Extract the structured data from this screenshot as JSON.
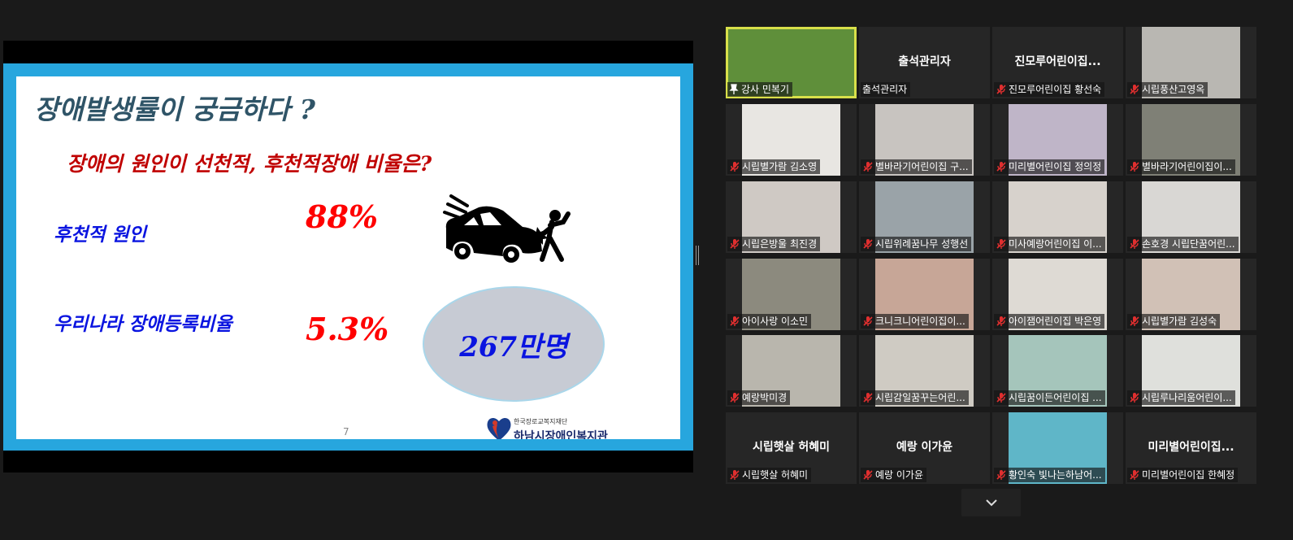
{
  "slide": {
    "title": "장애발생률이 궁금하다 ?",
    "question": "장애의 원인이 선천적, 후천적장애 비율은?",
    "acquired_label": "후천적 원인",
    "acquired_value": "88%",
    "registered_label": "우리나라 장애등록비율",
    "registered_value": "5.3%",
    "registered_count": "267만명",
    "page_number": "7",
    "org_sub": "한국장로교복지재단",
    "org_name": "하남시장애인복지관"
  },
  "participants": [
    {
      "label": "강사 민복기",
      "pinned": true,
      "active": true,
      "video": "#5f8f3a"
    },
    {
      "big": "출석관리자",
      "label": "출석관리자",
      "muted": false
    },
    {
      "big": "진모루어린이집...",
      "label": "진모루어린이집 황선숙",
      "muted": true
    },
    {
      "label": "시립풍산고영옥",
      "muted": true,
      "video": "#b9b7b2"
    },
    {
      "label": "시립별가람 김소영",
      "muted": true,
      "video": "#e8e6e2"
    },
    {
      "label": "별바라기어린이집 구...",
      "muted": true,
      "video": "#c8c4c0"
    },
    {
      "label": "미리별어린이집 정의정",
      "muted": true,
      "video": "#bfb5c8"
    },
    {
      "label": "별바라기어린이집이...",
      "muted": true,
      "video": "#7f8076"
    },
    {
      "label": "시립은방울 최진경",
      "muted": true,
      "video": "#cfc9c4"
    },
    {
      "label": "시립위례꿈나무 성행선",
      "muted": true,
      "video": "#9aa3a8"
    },
    {
      "label": "미사예랑어린이집 이...",
      "muted": true,
      "video": "#d7d2cc"
    },
    {
      "label": "손호경 시립단꿈어린...",
      "muted": true,
      "video": "#d9d7d4"
    },
    {
      "label": "아이사랑 이소민",
      "muted": true,
      "video": "#8c8a7e"
    },
    {
      "label": "크니크니어린이집이...",
      "muted": true,
      "video": "#c7a697"
    },
    {
      "label": "아이잼어린이집 박은영",
      "muted": true,
      "video": "#dedad4"
    },
    {
      "label": "시립별가람 김성숙",
      "muted": true,
      "video": "#d1c1b6"
    },
    {
      "label": "예랑박미경",
      "muted": true,
      "video": "#b9b6ad"
    },
    {
      "label": "시립감일꿈꾸는어린...",
      "muted": true,
      "video": "#cfcbc3"
    },
    {
      "label": "시립꿈이든어린이집 ...",
      "muted": true,
      "video": "#a5c5bb"
    },
    {
      "label": "시립루나리움어린이...",
      "muted": true,
      "video": "#dfe0dc"
    },
    {
      "big": "시립햇살 허혜미",
      "label": "시립햇살 허혜미",
      "muted": true
    },
    {
      "big": "예랑 이가윤",
      "label": "예랑 이가윤",
      "muted": true
    },
    {
      "label": "황인숙 빛나는하남어...",
      "muted": true,
      "video": "#5fb6c8"
    },
    {
      "big": "미리별어린이집...",
      "label": "미리별어린이집 한혜정",
      "muted": true
    }
  ],
  "colors": {
    "background": "#1a1a1a",
    "tile": "#262626",
    "active_border": "#d8e04a",
    "slide_frame": "#27a6de",
    "mute_red": "#e02f2f"
  }
}
